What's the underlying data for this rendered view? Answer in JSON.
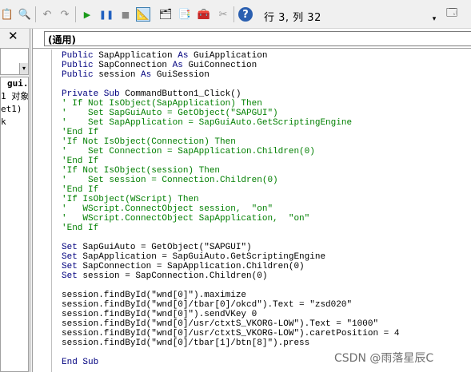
{
  "toolbar": {
    "position_label": "行 3, 列 32",
    "dropdown_arrow": "▾"
  },
  "left_panel": {
    "close_symbol": "✕",
    "combo_arrow": "▾",
    "items": [
      "gui.",
      "1 对象",
      "et1)",
      "k"
    ]
  },
  "code_window": {
    "procedure": "(通用)"
  },
  "code_lines": [
    [
      {
        "t": "Public",
        "c": "kw"
      },
      {
        "t": " SapApplication ",
        "c": "txt"
      },
      {
        "t": "As",
        "c": "kw"
      },
      {
        "t": " GuiApplication",
        "c": "txt"
      }
    ],
    [
      {
        "t": "Public",
        "c": "kw"
      },
      {
        "t": " SapConnection ",
        "c": "txt"
      },
      {
        "t": "As",
        "c": "kw"
      },
      {
        "t": " GuiConnection",
        "c": "txt"
      }
    ],
    [
      {
        "t": "Public",
        "c": "kw"
      },
      {
        "t": " session ",
        "c": "txt"
      },
      {
        "t": "As",
        "c": "kw"
      },
      {
        "t": " GuiSession",
        "c": "txt"
      }
    ],
    [],
    [
      {
        "t": "Private Sub",
        "c": "kw"
      },
      {
        "t": " CommandButton1_Click()",
        "c": "txt"
      }
    ],
    [
      {
        "t": "' If Not IsObject(SapApplication) Then",
        "c": "cm"
      }
    ],
    [
      {
        "t": "'    Set SapGuiAuto = GetObject(\"SAPGUI\")",
        "c": "cm"
      }
    ],
    [
      {
        "t": "'    Set SapApplication = SapGuiAuto.GetScriptingEngine",
        "c": "cm"
      }
    ],
    [
      {
        "t": "'End If",
        "c": "cm"
      }
    ],
    [
      {
        "t": "'If Not IsObject(Connection) Then",
        "c": "cm"
      }
    ],
    [
      {
        "t": "'    Set Connection = SapApplication.Children(0)",
        "c": "cm"
      }
    ],
    [
      {
        "t": "'End If",
        "c": "cm"
      }
    ],
    [
      {
        "t": "'If Not IsObject(session) Then",
        "c": "cm"
      }
    ],
    [
      {
        "t": "'    Set session = Connection.Children(0)",
        "c": "cm"
      }
    ],
    [
      {
        "t": "'End If",
        "c": "cm"
      }
    ],
    [
      {
        "t": "'If IsObject(WScript) Then",
        "c": "cm"
      }
    ],
    [
      {
        "t": "'   WScript.ConnectObject session,  \"on\"",
        "c": "cm"
      }
    ],
    [
      {
        "t": "'   WScript.ConnectObject SapApplication,  \"on\"",
        "c": "cm"
      }
    ],
    [
      {
        "t": "'End If",
        "c": "cm"
      }
    ],
    [],
    [
      {
        "t": "Set",
        "c": "kw"
      },
      {
        "t": " SapGuiAuto = GetObject(\"SAPGUI\")",
        "c": "txt"
      }
    ],
    [
      {
        "t": "Set",
        "c": "kw"
      },
      {
        "t": " SapApplication = SapGuiAuto.GetScriptingEngine",
        "c": "txt"
      }
    ],
    [
      {
        "t": "Set",
        "c": "kw"
      },
      {
        "t": " SapConnection = SapApplication.Children(0)",
        "c": "txt"
      }
    ],
    [
      {
        "t": "Set",
        "c": "kw"
      },
      {
        "t": " session = SapConnection.Children(0)",
        "c": "txt"
      }
    ],
    [],
    [
      {
        "t": "session.findById(\"wnd[0]\").maximize",
        "c": "txt"
      }
    ],
    [
      {
        "t": "session.findById(\"wnd[0]/tbar[0]/okcd\").Text = \"zsd020\"",
        "c": "txt"
      }
    ],
    [
      {
        "t": "session.findById(\"wnd[0]\").sendVKey 0",
        "c": "txt"
      }
    ],
    [
      {
        "t": "session.findById(\"wnd[0]/usr/ctxtS_VKORG-LOW\").Text = \"1000\"",
        "c": "txt"
      }
    ],
    [
      {
        "t": "session.findById(\"wnd[0]/usr/ctxtS_VKORG-LOW\").caretPosition = 4",
        "c": "txt"
      }
    ],
    [
      {
        "t": "session.findById(\"wnd[0]/tbar[1]/btn[8]\").press",
        "c": "txt"
      }
    ],
    [],
    [
      {
        "t": "End Sub",
        "c": "kw"
      }
    ]
  ],
  "watermark": "CSDN @雨落星辰C",
  "colors": {
    "keyword": "#00007f",
    "comment": "#007f00",
    "selected_tool": "#cde4f7"
  }
}
